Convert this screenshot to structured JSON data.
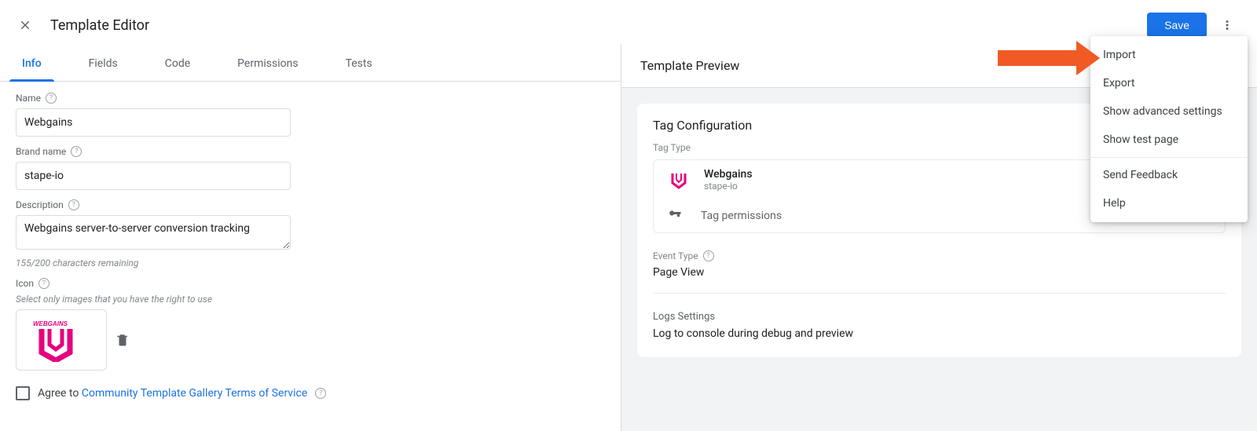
{
  "header": {
    "title": "Template Editor",
    "save_label": "Save"
  },
  "tabs": [
    {
      "id": "info",
      "label": "Info",
      "active": true
    },
    {
      "id": "fields",
      "label": "Fields",
      "active": false
    },
    {
      "id": "code",
      "label": "Code",
      "active": false
    },
    {
      "id": "permissions",
      "label": "Permissions",
      "active": false
    },
    {
      "id": "tests",
      "label": "Tests",
      "active": false
    }
  ],
  "form": {
    "name_label": "Name",
    "name_value": "Webgains",
    "brand_label": "Brand name",
    "brand_value": "stape-io",
    "description_label": "Description",
    "description_value": "Webgains server-to-server conversion tracking",
    "description_remaining": "155/200 characters remaining",
    "icon_label": "Icon",
    "icon_helper": "Select only images that you have the right to use",
    "icon_name": "WEBGAINS",
    "tos_prefix": "Agree to ",
    "tos_link": "Community Template Gallery Terms of Service"
  },
  "preview": {
    "title": "Template Preview",
    "card_title": "Tag Configuration",
    "tag_type_label": "Tag Type",
    "tag_name": "Webgains",
    "tag_brand": "stape-io",
    "tag_permissions_label": "Tag permissions",
    "event_type_label": "Event Type",
    "event_type_value": "Page View",
    "logs_label": "Logs Settings",
    "logs_value": "Log to console during debug and preview"
  },
  "menu": {
    "items": [
      "Import",
      "Export",
      "Show advanced settings",
      "Show test page"
    ],
    "footer_items": [
      "Send Feedback",
      "Help"
    ]
  }
}
